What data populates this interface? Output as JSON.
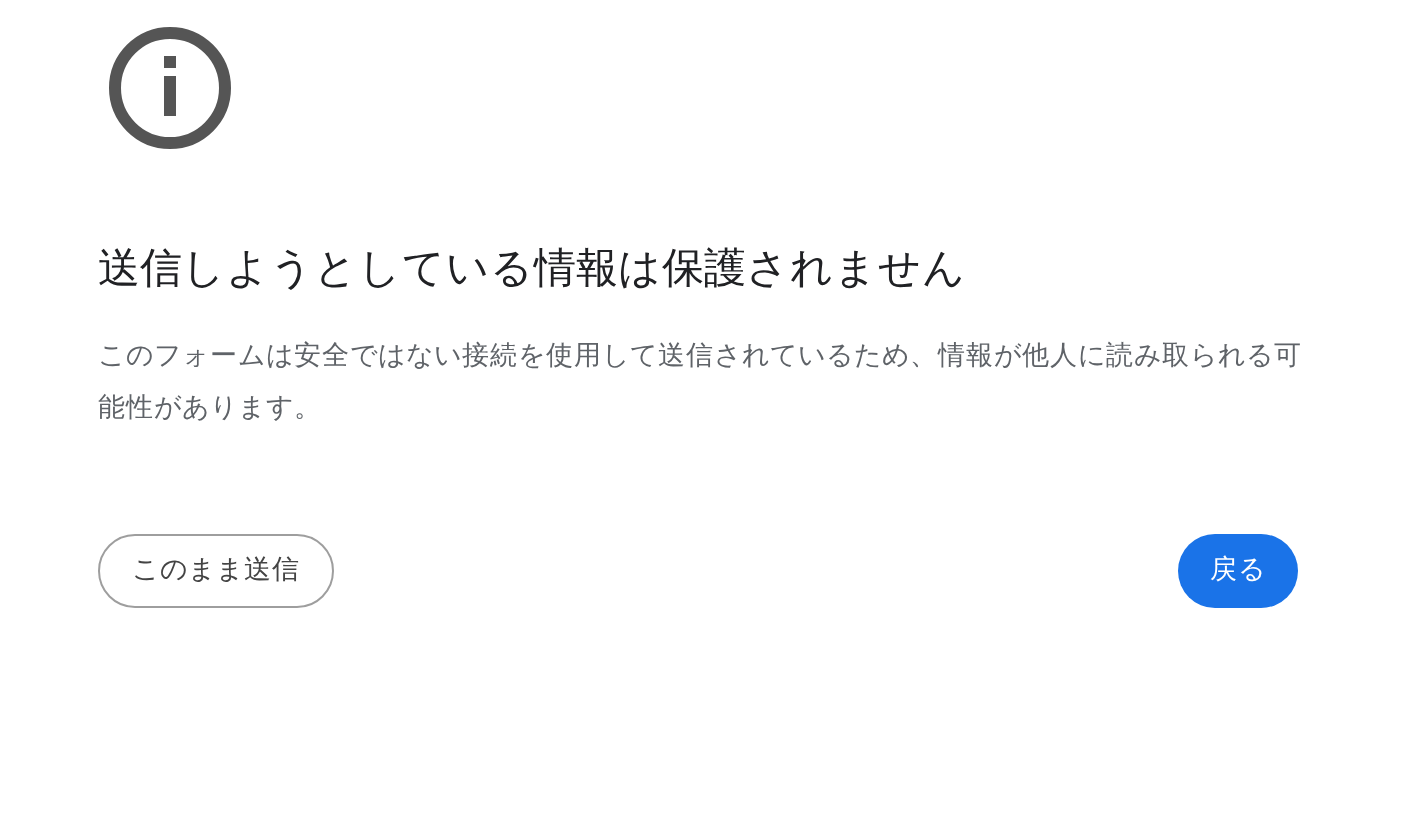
{
  "title": "送信しようとしている情報は保護されません",
  "message": "このフォームは安全ではない接続を使用して送信されているため、情報が他人に読み取られる可能性があります。",
  "buttons": [
    {
      "label": "このまま送信",
      "kind": "secondary"
    },
    {
      "label": "戻る",
      "kind": "primary"
    }
  ]
}
